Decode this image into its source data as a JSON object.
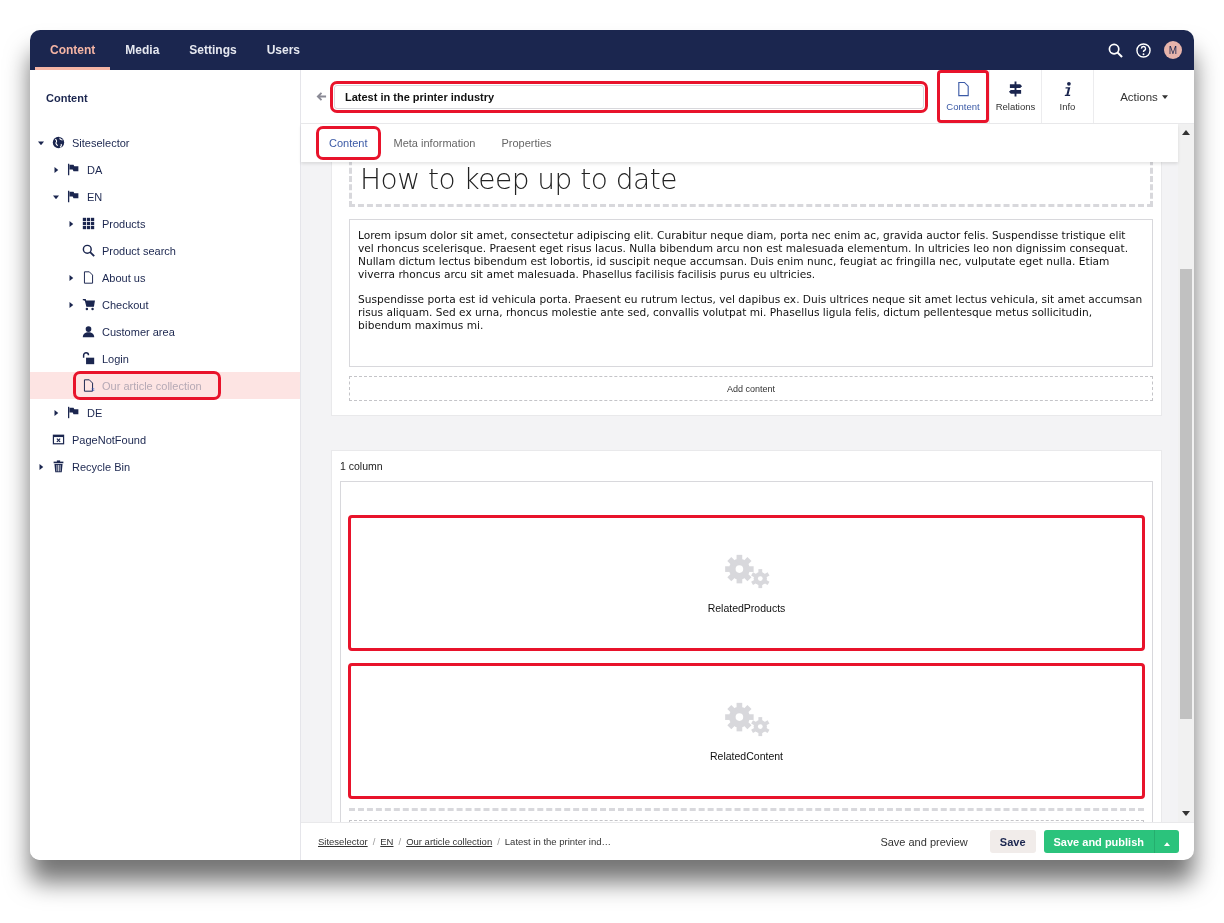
{
  "top_nav": {
    "sections": [
      {
        "label": "Content",
        "selected": true
      },
      {
        "label": "Media",
        "selected": false
      },
      {
        "label": "Settings",
        "selected": false
      },
      {
        "label": "Users",
        "selected": false
      }
    ],
    "avatar": "M"
  },
  "sidebar": {
    "title": "Content",
    "tree": [
      {
        "label": "Siteselector",
        "kind": "globe",
        "expanded": true,
        "selected": false,
        "highlighted": false,
        "children": [
          {
            "label": "DA",
            "kind": "flag",
            "expanded": false,
            "selected": false,
            "highlighted": false
          },
          {
            "label": "EN",
            "kind": "flag",
            "expanded": true,
            "selected": false,
            "highlighted": false,
            "children": [
              {
                "label": "Products",
                "kind": "grid",
                "expanded": false,
                "selected": false,
                "highlighted": false
              },
              {
                "label": "Product search",
                "kind": "search",
                "selected": false,
                "highlighted": false
              },
              {
                "label": "About us",
                "kind": "document",
                "expanded": false,
                "selected": false,
                "highlighted": false
              },
              {
                "label": "Checkout",
                "kind": "cart",
                "expanded": false,
                "selected": false,
                "highlighted": false
              },
              {
                "label": "Customer area",
                "kind": "user",
                "selected": false,
                "highlighted": false
              },
              {
                "label": "Login",
                "kind": "unlock",
                "selected": false,
                "highlighted": false
              },
              {
                "label": "Our article collection",
                "kind": "document_list",
                "selected": true,
                "highlighted": true
              }
            ]
          },
          {
            "label": "DE",
            "kind": "flag",
            "expanded": false,
            "selected": false,
            "highlighted": false
          }
        ]
      },
      {
        "label": "PageNotFound",
        "kind": "window_x",
        "selected": false,
        "highlighted": false
      },
      {
        "label": "Recycle Bin",
        "kind": "trash",
        "expanded": false,
        "selected": false,
        "highlighted": false
      }
    ]
  },
  "header": {
    "name": "Latest in the printer industry",
    "name_highlighted": true,
    "apps": [
      {
        "label": "Content",
        "kind": "document",
        "selected": true,
        "highlighted": true
      },
      {
        "label": "Relations",
        "kind": "signpost",
        "selected": false,
        "highlighted": false
      },
      {
        "label": "Info",
        "kind": "info",
        "selected": false,
        "highlighted": false
      }
    ],
    "actions": "Actions"
  },
  "tabs": [
    {
      "label": "Content",
      "selected": true,
      "highlighted": true
    },
    {
      "label": "Meta information",
      "selected": false,
      "highlighted": false
    },
    {
      "label": "Properties",
      "selected": false,
      "highlighted": false
    }
  ],
  "editor": {
    "heading": "How to keep up to date",
    "paragraphs": [
      "Lorem ipsum dolor sit amet, consectetur adipiscing elit. Curabitur neque diam, porta nec enim ac, gravida auctor felis. Suspendisse tristique elit vel rhoncus scelerisque. Praesent eget risus lacus. Nulla bibendum arcu non est malesuada elementum. In ultricies leo non dignissim consequat. Nullam dictum lectus bibendum est lobortis, id suscipit neque accumsan. Duis enim nunc, feugiat ac fringilla nec, vulputate eget nulla. Etiam viverra rhoncus arcu sit amet malesuada. Phasellus facilisis facilisis purus eu ultricies.",
      "Suspendisse porta est id vehicula porta. Praesent eu rutrum lectus, vel dapibus ex. Duis ultrices neque sit amet lectus vehicula, sit amet accumsan risus aliquam. Sed ex urna, rhoncus molestie ante sed, convallis volutpat mi. Phasellus ligula felis, dictum pellentesque metus sollicitudin, bibendum maximus mi."
    ],
    "add_content": "Add content",
    "section_title": "1 column",
    "blocks": [
      {
        "name": "RelatedProducts",
        "highlighted": true
      },
      {
        "name": "RelatedContent",
        "highlighted": true
      }
    ]
  },
  "footer": {
    "breadcrumbs": [
      {
        "label": "Siteselector",
        "kind": "link"
      },
      {
        "label": "/",
        "kind": "separator"
      },
      {
        "label": "EN",
        "kind": "link"
      },
      {
        "label": "/",
        "kind": "separator"
      },
      {
        "label": "Our article collection",
        "kind": "link"
      },
      {
        "label": "/",
        "kind": "separator"
      },
      {
        "label": "Latest in the printer ind…",
        "kind": "current"
      }
    ],
    "buttons": [
      {
        "label": "Save and preview",
        "kind": "link"
      },
      {
        "label": "Save",
        "kind": "secondary"
      },
      {
        "label": "Save and publish",
        "kind": "primary"
      }
    ]
  }
}
